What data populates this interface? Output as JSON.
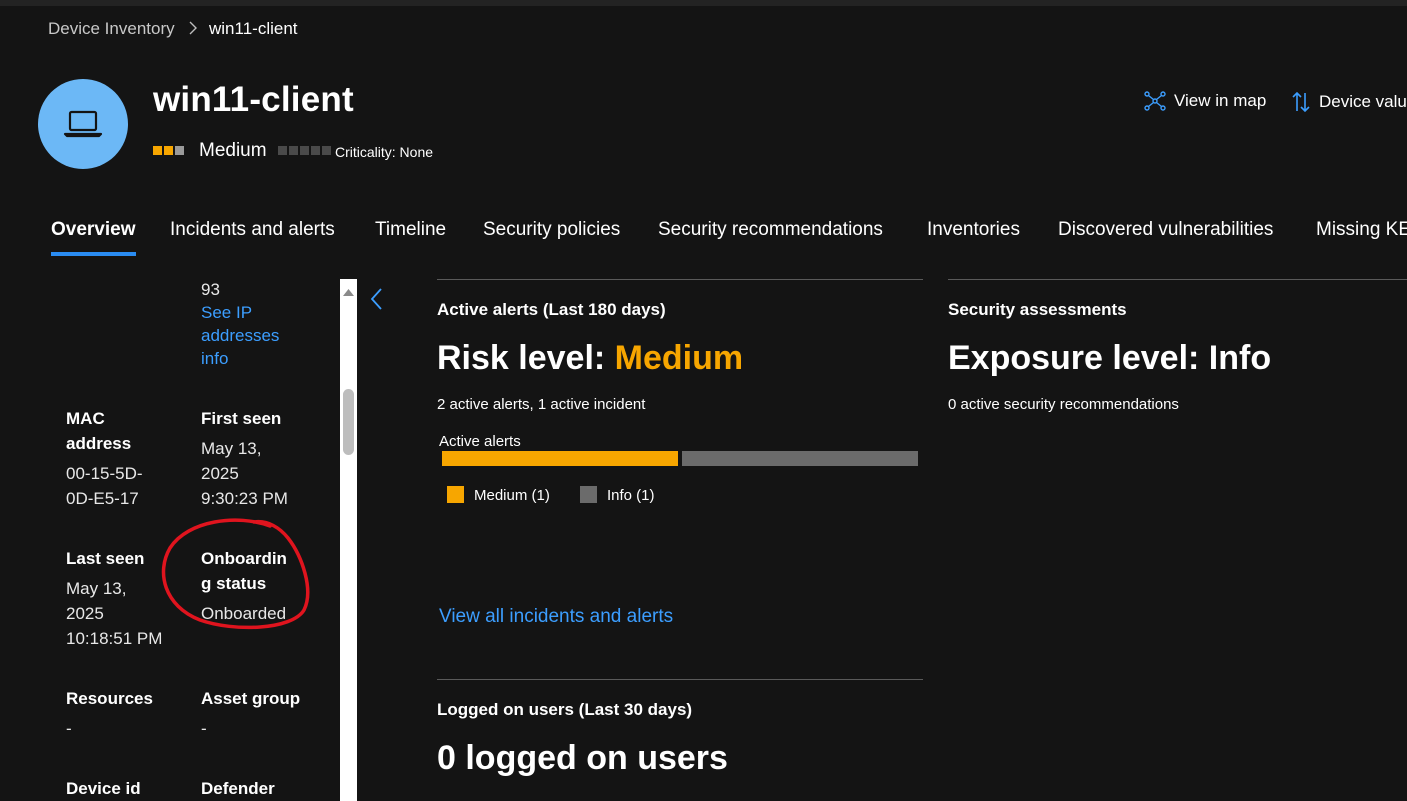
{
  "colors": {
    "accent_blue": "#2a8cf2",
    "link_blue": "#3c9eff",
    "medium_orange": "#f7a600",
    "info_gray": "#6b6b6b",
    "avatar_blue": "#6cb8f6",
    "annotation_red": "#e0141e"
  },
  "breadcrumb": {
    "root": "Device Inventory",
    "current": "win11-client",
    "separator_icon": "chevron-right-icon"
  },
  "header": {
    "device_icon": "laptop-icon",
    "device_name": "win11-client",
    "risk_level": "Medium",
    "criticality": "Criticality: None",
    "actions": [
      {
        "label": "View in map",
        "icon": "map-icon"
      },
      {
        "label": "Device valu",
        "icon": "sort-arrows-icon"
      }
    ]
  },
  "tabs": [
    {
      "label": "Overview",
      "active": true
    },
    {
      "label": "Incidents and alerts"
    },
    {
      "label": "Timeline"
    },
    {
      "label": "Security policies"
    },
    {
      "label": "Security recommendations"
    },
    {
      "label": "Inventories"
    },
    {
      "label": "Discovered vulnerabilities"
    },
    {
      "label": "Missing KE"
    }
  ],
  "properties": {
    "ip_partial": "93",
    "ip_link": [
      "See IP",
      "addresses",
      "info"
    ],
    "mac_label": [
      "MAC",
      "address"
    ],
    "mac_value": [
      "00-15-5D-",
      "0D-E5-17"
    ],
    "first_seen_label": "First seen",
    "first_seen_value": [
      "May 13,",
      "2025",
      "9:30:23 PM"
    ],
    "last_seen_label": "Last seen",
    "last_seen_value": [
      "May 13,",
      "2025",
      "10:18:51 PM"
    ],
    "onboarding_label": [
      "Onboardin",
      "g status"
    ],
    "onboarding_value": "Onboarded",
    "resources_label": "Resources",
    "resources_value": "-",
    "asset_group_label": "Asset group",
    "asset_group_value": "-",
    "device_id_label": "Device id",
    "defender_label": "Defender"
  },
  "active_alerts": {
    "header": "Active alerts (Last 180 days)",
    "risk_prefix": "Risk level: ",
    "risk_value": "Medium",
    "summary": "2 active alerts, 1 active incident",
    "bar_label": "Active alerts",
    "legend": [
      {
        "label": "Medium (1)",
        "color": "#f7a600",
        "count": 1
      },
      {
        "label": "Info (1)",
        "color": "#6b6b6b",
        "count": 1
      }
    ],
    "link": "View all incidents and alerts"
  },
  "security_assessments": {
    "header": "Security assessments",
    "exposure": "Exposure level: Info",
    "summary": "0 active security recommendations"
  },
  "logged_on_users": {
    "header": "Logged on users (Last 30 days)",
    "count_text": "0 logged on users"
  }
}
